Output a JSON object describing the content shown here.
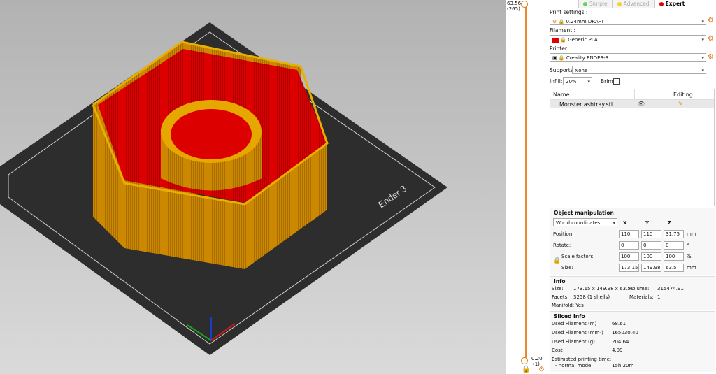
{
  "colors": {
    "orange": "#E07A16",
    "model": "#CC8800",
    "infill": "#E00000",
    "bed": "#2D2D2D"
  },
  "viewport": {
    "bed_label": "Ender 3"
  },
  "slider": {
    "top_value": "63.56",
    "top_layer": "(265)",
    "bottom_value": "0.20",
    "bottom_layer": "(1)"
  },
  "mode_tabs": [
    {
      "label": "Simple",
      "color": "#5FD35F"
    },
    {
      "label": "Advanced",
      "color": "#F3D22B"
    },
    {
      "label": "Expert",
      "color": "#E00000"
    }
  ],
  "print_settings": {
    "label": "Print settings :",
    "value": "0.24mm DRAFT"
  },
  "filament": {
    "label": "Filament :",
    "value": "Generic PLA"
  },
  "printer": {
    "label": "Printer :",
    "value": "Creality ENDER-3"
  },
  "supports": {
    "label": "Supports:",
    "value": "None"
  },
  "infill": {
    "label": "Infill:",
    "value": "20%"
  },
  "brim": {
    "label": "Brim:"
  },
  "object_list": {
    "col_name": "Name",
    "col_editing": "Editing",
    "items": [
      {
        "name": "Monster ashtray.stl"
      }
    ]
  },
  "object_manipulation": {
    "title": "Object manipulation",
    "coord_system": "World coordinates",
    "axes": [
      "X",
      "Y",
      "Z"
    ],
    "rows": [
      {
        "label": "Position:",
        "values": [
          "110",
          "110",
          "31.75"
        ],
        "unit": "mm"
      },
      {
        "label": "Rotate:",
        "values": [
          "0",
          "0",
          "0"
        ],
        "unit": "°"
      },
      {
        "label": "Scale factors:",
        "values": [
          "100",
          "100",
          "100"
        ],
        "unit": "%"
      },
      {
        "label": "Size:",
        "values": [
          "173.15",
          "149.98",
          "63.5"
        ],
        "unit": "mm"
      }
    ]
  },
  "info": {
    "title": "Info",
    "size_label": "Size:",
    "size_value": "173.15 x 149.98 x 63.50",
    "volume_label": "Volume:",
    "volume_value": "315474.91",
    "facets_label": "Facets:",
    "facets_value": "3258 (1 shells)",
    "materials_label": "Materials:",
    "materials_value": "1",
    "manifold": "Manifold: Yes"
  },
  "sliced_info": {
    "title": "Sliced Info",
    "rows": [
      {
        "label": "Used Filament (m)",
        "value": "68.61"
      },
      {
        "label": "Used Filament (mm³)",
        "value": "165030.40"
      },
      {
        "label": "Used Filament (g)",
        "value": "204.64"
      },
      {
        "label": "Cost",
        "value": "4.09"
      }
    ],
    "time_label": "Estimated printing time:",
    "mode_label": "- normal mode",
    "mode_value": "15h 20m"
  }
}
